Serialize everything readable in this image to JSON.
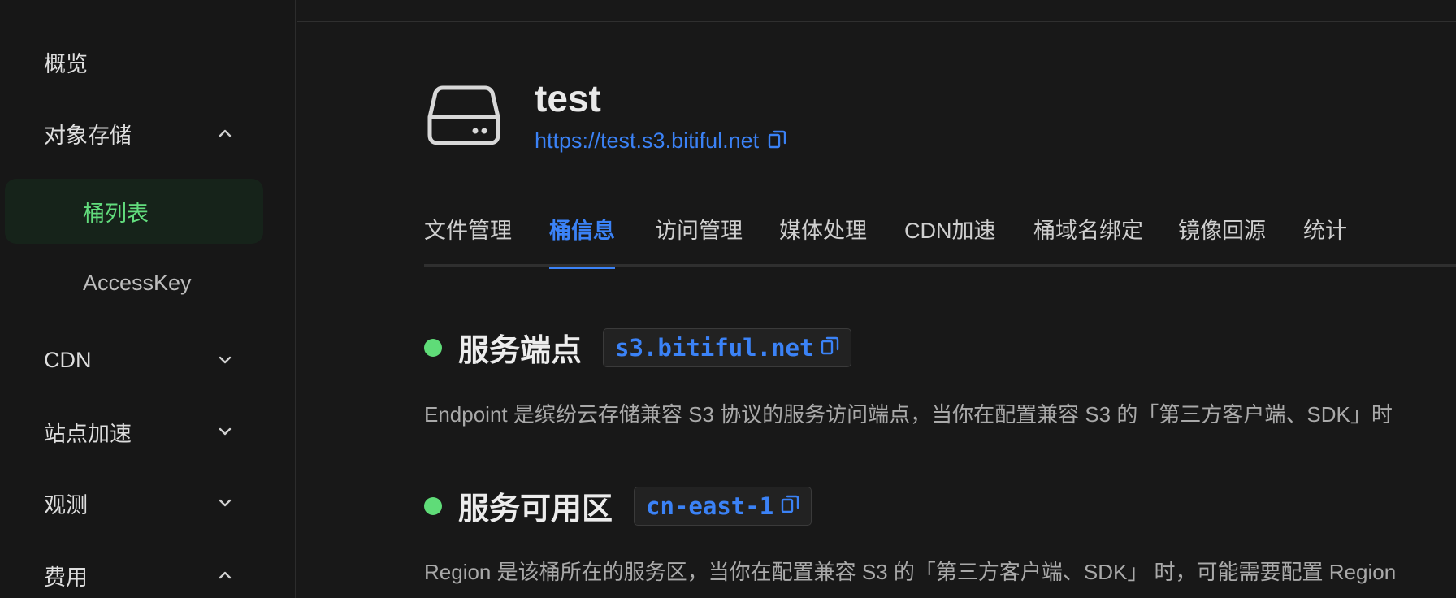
{
  "sidebar": {
    "overview": "概览",
    "object_storage": {
      "label": "对象存储",
      "expanded": true
    },
    "bucket_list": "桶列表",
    "access_key": "AccessKey",
    "cdn": {
      "label": "CDN",
      "expanded": false
    },
    "site_accel": {
      "label": "站点加速",
      "expanded": false
    },
    "observe": {
      "label": "观测",
      "expanded": false
    },
    "billing": {
      "label": "费用",
      "expanded": true
    }
  },
  "bucket": {
    "name": "test",
    "url": "https://test.s3.bitiful.net"
  },
  "tabs": [
    {
      "label": "文件管理",
      "active": false
    },
    {
      "label": "桶信息",
      "active": true
    },
    {
      "label": "访问管理",
      "active": false
    },
    {
      "label": "媒体处理",
      "active": false
    },
    {
      "label": "CDN加速",
      "active": false
    },
    {
      "label": "桶域名绑定",
      "active": false
    },
    {
      "label": "镜像回源",
      "active": false
    },
    {
      "label": "统计",
      "active": false
    }
  ],
  "endpoint": {
    "title": "服务端点",
    "value": "s3.bitiful.net",
    "description": "Endpoint 是缤纷云存储兼容 S3 协议的服务访问端点，当你在配置兼容 S3 的「第三方客户端、SDK」时"
  },
  "region": {
    "title": "服务可用区",
    "value": "cn-east-1",
    "description": "Region 是该桶所在的服务区，当你在配置兼容 S3 的「第三方客户端、SDK」 时，可能需要配置 Region"
  },
  "colors": {
    "accent": "#3b82f6",
    "active_green": "#62dd7d",
    "status_dot": "#5fdc78"
  }
}
